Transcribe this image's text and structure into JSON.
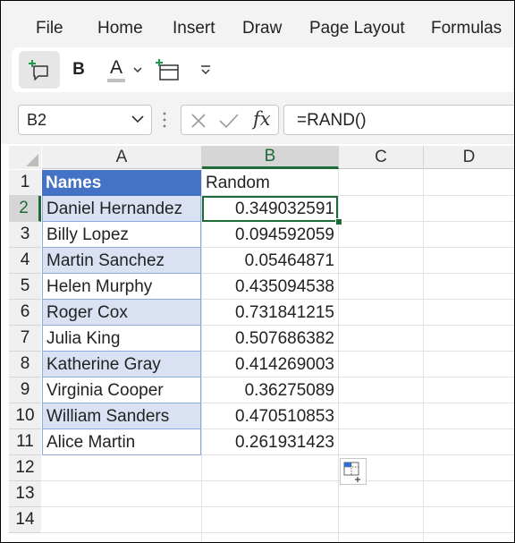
{
  "ribbon": {
    "tabs": [
      "File",
      "Home",
      "Insert",
      "Draw",
      "Page Layout",
      "Formulas"
    ]
  },
  "toolbar": {
    "icons": [
      "new-comment-icon",
      "bold-icon",
      "font-color-icon",
      "dropdown-chevron-icon",
      "insert-table-icon",
      "customize-toolbar-icon"
    ],
    "bold_label": "B",
    "font_color_label": "A",
    "font_color": "#c0c0c0"
  },
  "formula_bar": {
    "name_box": "B2",
    "formula": "=RAND()",
    "fx_label": "fx"
  },
  "sheet": {
    "columns": [
      "A",
      "B",
      "C",
      "D"
    ],
    "rows": [
      "1",
      "2",
      "3",
      "4",
      "5",
      "6",
      "7",
      "8",
      "9",
      "10",
      "11",
      "12",
      "13",
      "14"
    ],
    "active_cell": "B2",
    "header_color": "#4472c4",
    "band_color": "#d9e1f2",
    "header": {
      "a": "Names",
      "b": "Random"
    },
    "data": [
      {
        "name": "Daniel Hernandez",
        "value": "0.349032591"
      },
      {
        "name": "Billy Lopez",
        "value": "0.094592059"
      },
      {
        "name": "Martin Sanchez",
        "value": "0.05464871"
      },
      {
        "name": "Helen Murphy",
        "value": "0.435094538"
      },
      {
        "name": "Roger Cox",
        "value": "0.731841215"
      },
      {
        "name": "Julia King",
        "value": "0.507686382"
      },
      {
        "name": "Katherine Gray",
        "value": "0.414269003"
      },
      {
        "name": "Virginia Cooper",
        "value": "0.36275089"
      },
      {
        "name": "William Sanders",
        "value": "0.470510853"
      },
      {
        "name": "Alice Martin",
        "value": "0.261931423"
      }
    ]
  },
  "quick_analysis": {
    "icon": "quick-analysis-icon"
  }
}
